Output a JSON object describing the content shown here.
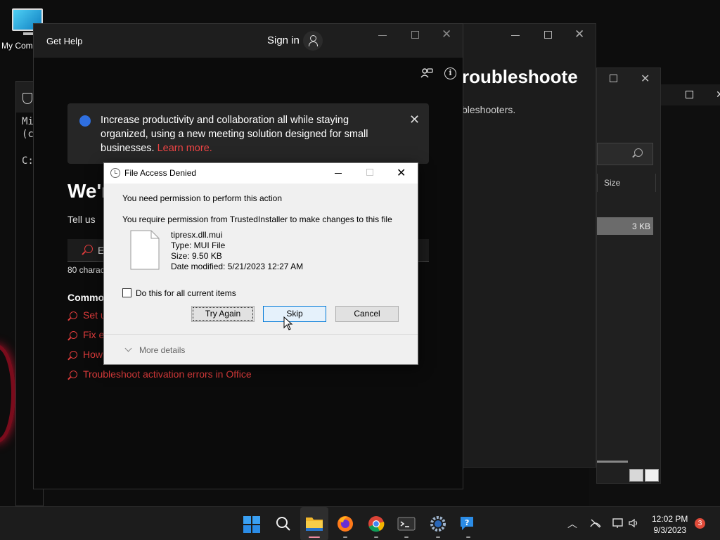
{
  "desktop": {
    "icon_label": "My Com"
  },
  "cmd": {
    "line1": "Mi",
    "line2": "(c",
    "line3": "C:"
  },
  "troubleshoot": {
    "title": "roubleshoote",
    "subtitle": "bleshooters."
  },
  "explorer": {
    "column_size": "Size",
    "selected_size": "3 KB"
  },
  "gethelp": {
    "app_title": "Get Help",
    "sign_in": "Sign in",
    "banner_text": "Increase productivity and collaboration all while staying organized, using a new meeting solution designed for small businesses.",
    "banner_link": "Learn more.",
    "heading": "We'r",
    "tell_us": "Tell us",
    "search_text": "E",
    "char_count": "80 charac",
    "common_heading": "Commo",
    "links": [
      "Set u",
      "Fix e",
      "How",
      "Troubleshoot activation errors in Office"
    ]
  },
  "dialog": {
    "title": "File Access Denied",
    "message1": "You need permission to perform this action",
    "message2": "You require permission from TrustedInstaller to make changes to this file",
    "file_name": "tipresx.dll.mui",
    "file_type": "Type: MUI File",
    "file_size": "Size: 9.50 KB",
    "file_date": "Date modified: 5/21/2023 12:27 AM",
    "checkbox_label": "Do this for all current items",
    "btn_try_again": "Try Again",
    "btn_skip": "Skip",
    "btn_cancel": "Cancel",
    "more_details": "More details"
  },
  "taskbar": {
    "time": "12:02 PM",
    "date": "9/3/2023",
    "notification_count": "3",
    "apps": [
      "start-icon",
      "search-icon",
      "file-explorer-icon",
      "firefox-icon",
      "chrome-icon",
      "terminal-icon",
      "settings-icon",
      "get-help-icon"
    ]
  },
  "colors": {
    "accent_red": "#e03c3c",
    "dialog_bg": "#f0f0f0",
    "skip_focus": "#0078d7"
  }
}
